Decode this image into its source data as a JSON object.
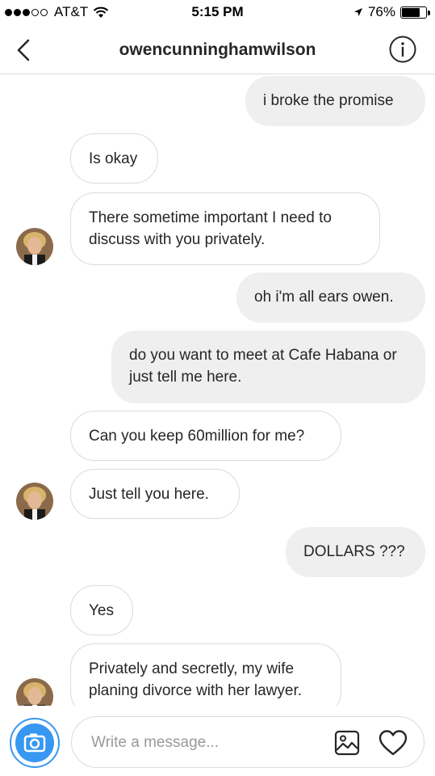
{
  "status_bar": {
    "carrier": "AT&T",
    "time": "5:15 PM",
    "battery_percent": "76%",
    "battery_level": 0.76,
    "signal_bars_filled": 3,
    "signal_bars_total": 5
  },
  "header": {
    "username": "owencunninghamwilson",
    "back_icon": "chevron-left-icon",
    "info_icon": "info-icon"
  },
  "messages": [
    {
      "side": "out",
      "text": "i broke the promise"
    },
    {
      "side": "in",
      "text": "Is okay"
    },
    {
      "side": "in",
      "text": "There sometime important I need to discuss with you privately."
    },
    {
      "side": "out",
      "text": "oh i'm all ears owen."
    },
    {
      "side": "out",
      "text": "do you want to meet at Cafe Habana or just tell me here."
    },
    {
      "side": "in",
      "text": "Can you keep 60million for me?"
    },
    {
      "side": "in",
      "text": "Just tell you here."
    },
    {
      "side": "out",
      "text": "DOLLARS ???"
    },
    {
      "side": "in",
      "text": "Yes"
    },
    {
      "side": "in",
      "text": "Privately and secretly, my wife planing divorce with her lawyer."
    }
  ],
  "composer": {
    "placeholder": "Write a message...",
    "camera_icon": "camera-icon",
    "gallery_icon": "gallery-icon",
    "heart_icon": "heart-icon"
  },
  "colors": {
    "accent": "#3897f0",
    "outgoing_bubble": "#efefef",
    "incoming_border": "#dbdbdb",
    "text": "#262626"
  }
}
